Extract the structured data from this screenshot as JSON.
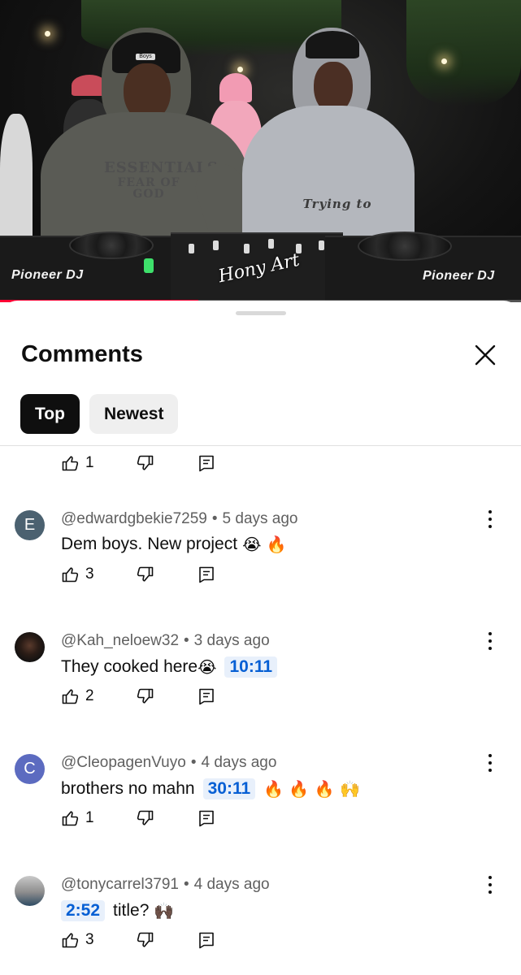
{
  "video": {
    "brand_left": "Pioneer DJ",
    "brand_right": "Pioneer DJ",
    "hoodie_print_line1": "ESSENTIALS",
    "hoodie_print_line2": "FEAR OF GOD",
    "hoodie2_print": "Trying to",
    "cap_badge": "Boys",
    "watermark": "Hony Art",
    "progress_fraction": 0.38,
    "progress_color": "#ff0033"
  },
  "panel": {
    "title": "Comments",
    "tabs": [
      {
        "label": "Top",
        "active": true
      },
      {
        "label": "Newest",
        "active": false
      }
    ]
  },
  "partial_comment": {
    "likes": "1"
  },
  "comments": [
    {
      "author": "@edwardgbekie7259",
      "time": "5 days ago",
      "avatar_letter": "E",
      "avatar_color": "#4b6170",
      "text": "Dem boys. New project",
      "emojis": "😭 🔥",
      "likes": "3"
    },
    {
      "author": "@Kah_neloew32",
      "time": "3 days ago",
      "avatar_letter": "",
      "avatar_color": "#1a1a1a",
      "text": "They cooked here",
      "emoji_after_text": "😭",
      "timestamp": "10:11",
      "likes": "2"
    },
    {
      "author": "@CleopagenVuyo",
      "time": "4 days ago",
      "avatar_letter": "C",
      "avatar_color": "#5c6bc0",
      "text": "brothers no mahn",
      "timestamp": "30:11",
      "emojis": "🔥 🔥 🔥 🙌",
      "likes": "1"
    },
    {
      "author": "@tonycarrel3791",
      "time": "4 days ago",
      "avatar_letter": "",
      "avatar_color": "#8d8d8d",
      "timestamp": "2:52",
      "text": "title?",
      "emojis": "🙌🏿",
      "likes": "3"
    }
  ],
  "icons": {
    "like": "thumb-up-icon",
    "dislike": "thumb-down-icon",
    "reply": "reply-comment-icon",
    "more": "more-vert-icon",
    "close": "close-icon"
  }
}
